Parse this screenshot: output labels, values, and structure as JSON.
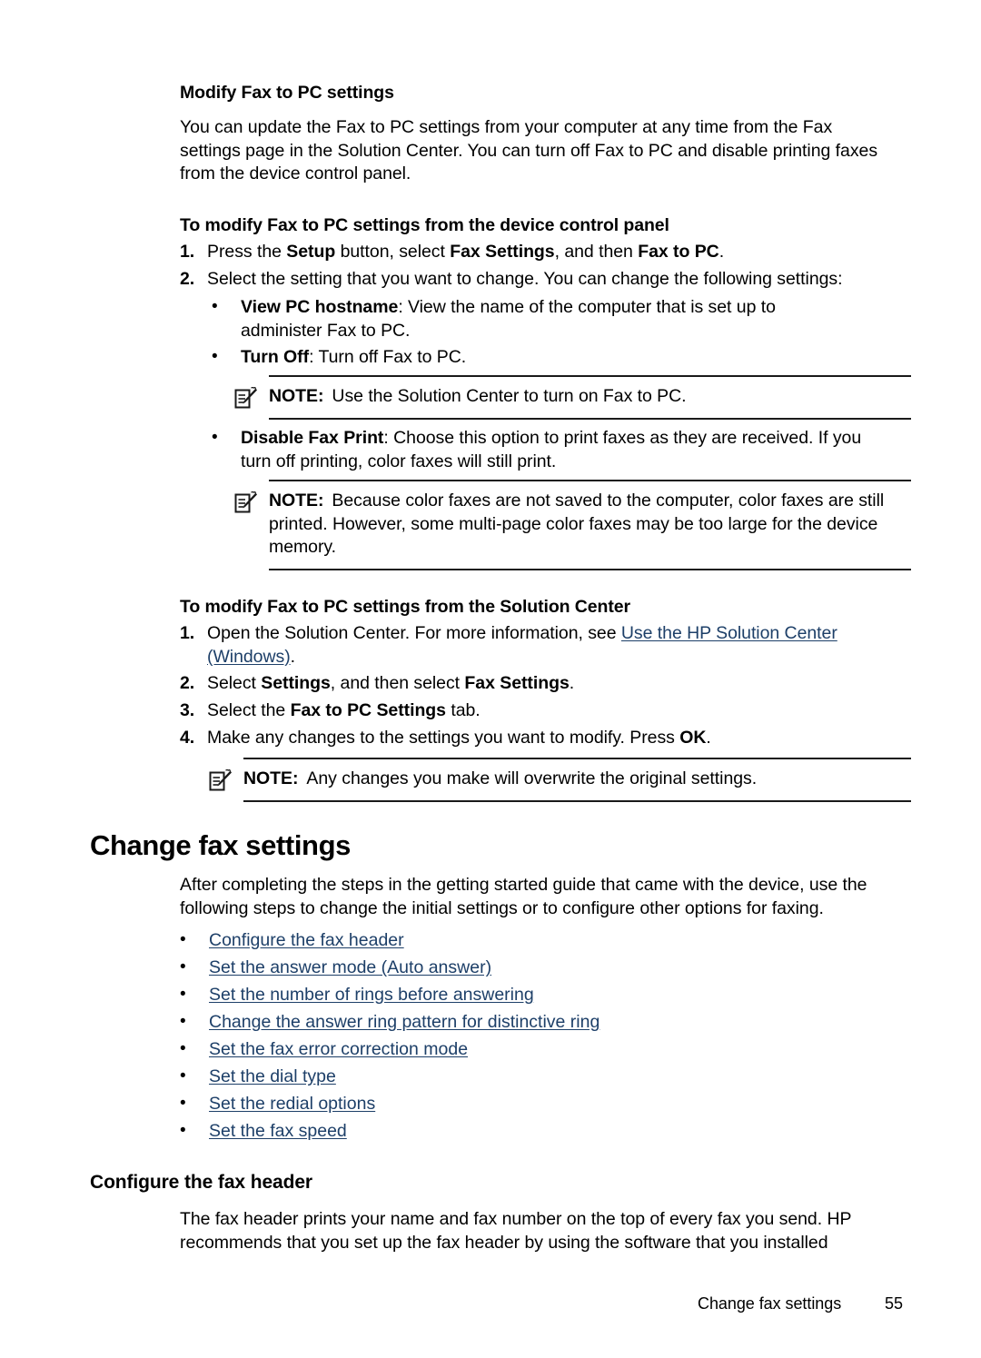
{
  "page": {
    "number": "55",
    "footer_section": "Change fax settings"
  },
  "sections": {
    "modify_fax_to_pc": {
      "heading": "Modify Fax to PC settings",
      "intro": "You can update the Fax to PC settings from your computer at any time from the Fax settings page in the Solution Center. You can turn off Fax to PC and disable printing faxes from the device control panel."
    },
    "device_control_panel": {
      "heading": "To modify Fax to PC settings from the device control panel",
      "steps": [
        {
          "number": "1.",
          "pre": "Press the ",
          "b1": "Setup",
          "mid1": " button, select ",
          "b2": "Fax Settings",
          "mid2": ", and then ",
          "b3": "Fax to PC",
          "post": "."
        },
        {
          "number": "2.",
          "text": "Select the setting that you want to change. You can change the following settings:"
        }
      ],
      "bullets": [
        {
          "marker": "•",
          "term": "View PC hostname",
          "desc": ": View the name of the computer that is set up to administer Fax to PC."
        },
        {
          "marker": "•",
          "term": "Turn Off",
          "desc": ": Turn off Fax to PC."
        },
        {
          "marker": "•",
          "term": "Disable Fax Print",
          "desc": ": Choose this option to print faxes as they are received. If you turn off printing, color faxes will still print."
        }
      ],
      "note_1": {
        "icon": "note-pencil-icon",
        "label": "NOTE:",
        "text": "Use the Solution Center to turn on Fax to PC."
      },
      "note_2": {
        "icon": "note-pencil-icon",
        "label": "NOTE:",
        "text": "Because color faxes are not saved to the computer, color faxes are still printed. However, some multi-page color faxes may be too large for the device memory."
      }
    },
    "solution_center": {
      "heading": "To modify Fax to PC settings from the Solution Center",
      "steps": [
        {
          "number": "1.",
          "pre": "Open the Solution Center. For more information, see ",
          "link": "Use the HP Solution Center (Windows)",
          "post": "."
        },
        {
          "number": "2.",
          "pre": "Select ",
          "b1": "Settings",
          "mid1": ", and then select ",
          "b2": "Fax Settings",
          "post": "."
        },
        {
          "number": "3.",
          "pre": "Select the ",
          "b1": "Fax to PC Settings",
          "post": " tab."
        },
        {
          "number": "4.",
          "pre": "Make any changes to the settings you want to modify. Press ",
          "b1": "OK",
          "post": "."
        }
      ],
      "note_3": {
        "icon": "note-pencil-icon",
        "label": "NOTE:",
        "text": "Any changes you make will overwrite the original settings."
      }
    },
    "change_fax_settings": {
      "heading": "Change fax settings",
      "intro": "After completing the steps in the getting started guide that came with the device, use the following steps to change the initial settings or to configure other options for faxing.",
      "links": [
        {
          "marker": "•",
          "label": "Configure the fax header"
        },
        {
          "marker": "•",
          "label": "Set the answer mode (Auto answer)"
        },
        {
          "marker": "•",
          "label": "Set the number of rings before answering"
        },
        {
          "marker": "•",
          "label": "Change the answer ring pattern for distinctive ring"
        },
        {
          "marker": "•",
          "label": "Set the fax error correction mode"
        },
        {
          "marker": "•",
          "label": "Set the dial type"
        },
        {
          "marker": "•",
          "label": "Set the redial options"
        },
        {
          "marker": "•",
          "label": "Set the fax speed"
        }
      ]
    },
    "configure_fax_header": {
      "heading": "Configure the fax header",
      "intro": "The fax header prints your name and fax number on the top of every fax you send. HP recommends that you set up the fax header by using the software that you installed"
    }
  },
  "colors": {
    "link": "#1d3f68",
    "text": "#000000",
    "rule": "#1a1a1a",
    "background": "#ffffff"
  }
}
